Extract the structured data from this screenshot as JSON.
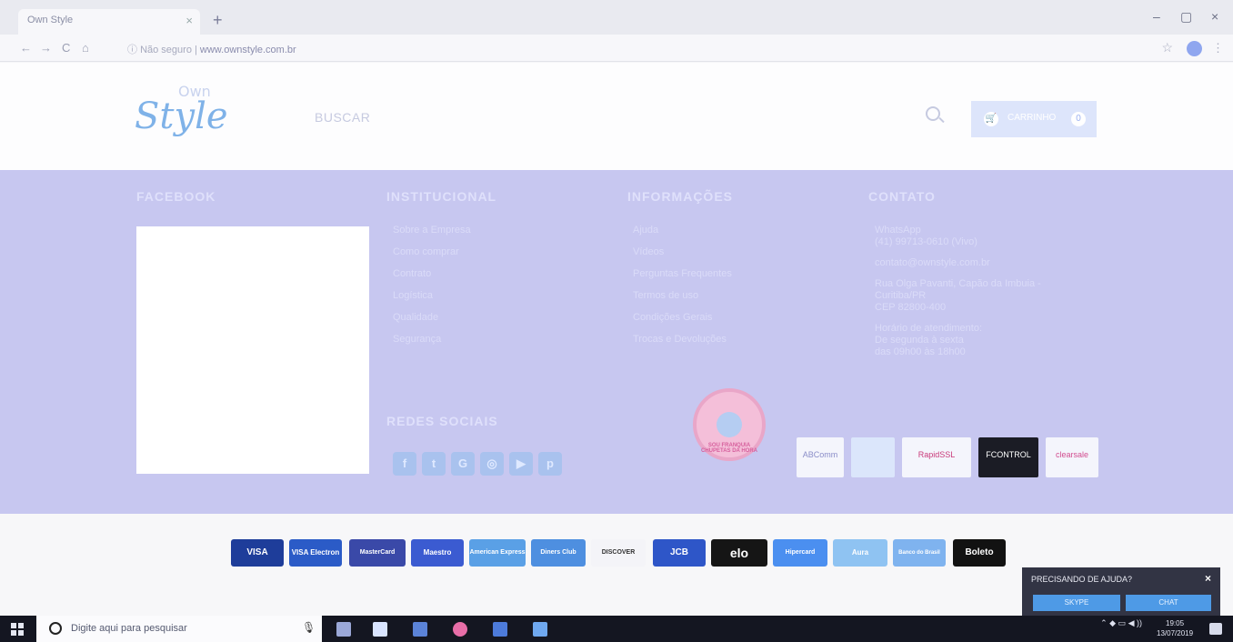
{
  "browser": {
    "tab_title": "Own Style",
    "tab_close": "×",
    "new_tab": "+",
    "back": "←",
    "forward": "→",
    "reload": "C",
    "home": "⌂",
    "security": "Não seguro",
    "url_separator": "|",
    "url": "www.ownstyle.com.br",
    "minimize": "–",
    "maximize": "▢",
    "close": "×"
  },
  "header": {
    "logo_own": "Own",
    "logo_style": "Style",
    "search_label": "BUSCAR",
    "cart_label": "CARRINHO",
    "cart_count": "0"
  },
  "footer": {
    "facebook_title": "FACEBOOK",
    "institutional_title": "INSTITUCIONAL",
    "institutional_links": [
      "Sobre a Empresa",
      "Como comprar",
      "Contrato",
      "Logística",
      "Qualidade",
      "Segurança"
    ],
    "info_title": "INFORMAÇÕES",
    "info_links": [
      "Ajuda",
      "Vídeos",
      "Perguntas Frequentes",
      "Termos de uso",
      "Condições Gerais",
      "Trocas e Devoluções"
    ],
    "contact_title": "CONTATO",
    "contact_lines": [
      "WhatsApp",
      "(41) 99713-0610 (Vivo)",
      "contato@ownstyle.com.br",
      "Rua Olga Pavanti, Capão da Imbuia - Curitiba/PR",
      "CEP 82800-400",
      "Horário de atendimento:",
      "De segunda à sexta",
      "das 09h00 às 18h00"
    ],
    "social_title": "REDES SOCIAIS",
    "social_icons": [
      "facebook-icon",
      "twitter-icon",
      "google-plus-icon",
      "instagram-icon",
      "youtube-icon",
      "pinterest-icon"
    ],
    "seals": [
      "SOU FRANQUIA CHUPETAS DA HORA",
      "ABComm",
      "RapidSSL",
      "FCONTROL",
      "clearsale"
    ]
  },
  "payments": [
    "VISA",
    "VISA Electron",
    "MasterCard",
    "Maestro",
    "American Express",
    "Diners Club",
    "DISCOVER",
    "JCB",
    "elo",
    "Hipercard",
    "Aura",
    "Banco do Brasil",
    "Boleto"
  ],
  "chat": {
    "title": "PRECISANDO DE AJUDA?",
    "close": "×",
    "skype": "SKYPE",
    "chat": "CHAT"
  },
  "taskbar": {
    "search_placeholder": "Digite aqui para pesquisar",
    "time": "19:05",
    "date": "13/07/2019"
  },
  "colors": {
    "footer_bg": "#c7c7f0",
    "accent_blue": "#7fb2e8"
  }
}
